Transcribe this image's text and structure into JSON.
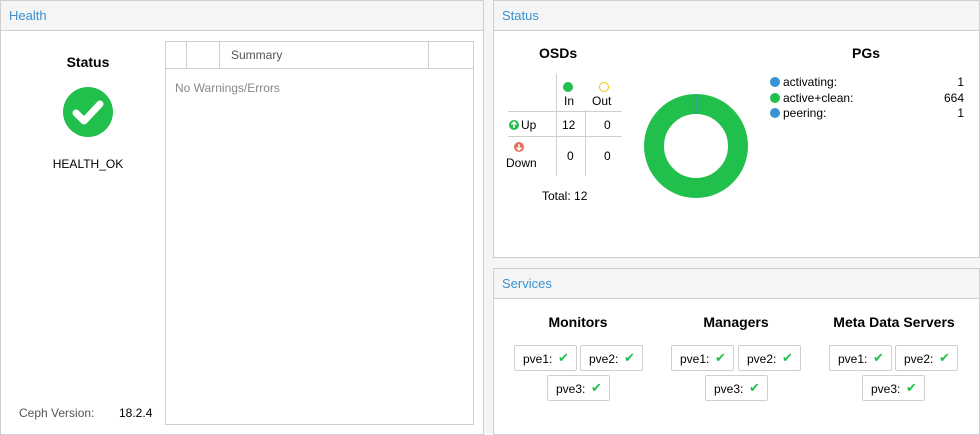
{
  "health": {
    "title": "Health",
    "status_title": "Status",
    "status_value": "HEALTH_OK",
    "grid": {
      "column_summary": "Summary",
      "empty_text": "No Warnings/Errors"
    },
    "version_label": "Ceph Version:",
    "version_value": "18.2.4"
  },
  "status": {
    "title": "Status",
    "osds": {
      "title": "OSDs",
      "col_in": "In",
      "col_out": "Out",
      "row_up": "Up",
      "row_down": "Down",
      "up_in": "12",
      "up_out": "0",
      "down_in": "0",
      "down_out": "0",
      "total": "Total: 12"
    },
    "pgs": {
      "title": "PGs",
      "items": [
        {
          "label": "activating:",
          "count": "1",
          "color": "#3892d4"
        },
        {
          "label": "active+clean:",
          "count": "664",
          "color": "#21bf4b"
        },
        {
          "label": "peering:",
          "count": "1",
          "color": "#3892d4"
        }
      ]
    }
  },
  "services": {
    "title": "Services",
    "groups": [
      {
        "title": "Monitors",
        "nodes": [
          "pve1:",
          "pve2:",
          "pve3:"
        ]
      },
      {
        "title": "Managers",
        "nodes": [
          "pve1:",
          "pve2:",
          "pve3:"
        ]
      },
      {
        "title": "Meta Data Servers",
        "nodes": [
          "pve1:",
          "pve2:",
          "pve3:"
        ]
      }
    ],
    "check_glyph": "✔"
  },
  "colors": {
    "accent": "#3892d4",
    "ok_green": "#21bf4b",
    "warn_yellow": "#f1c40f",
    "error_red": "#e76f5a"
  }
}
